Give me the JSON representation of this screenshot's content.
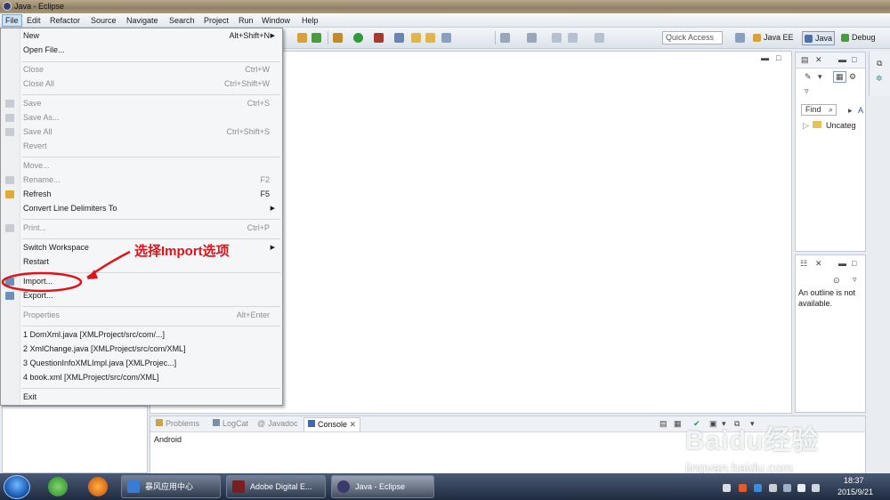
{
  "window": {
    "title": "Java - Eclipse"
  },
  "menubar": [
    "File",
    "Edit",
    "Refactor",
    "Source",
    "Navigate",
    "Search",
    "Project",
    "Run",
    "Window",
    "Help"
  ],
  "file_menu": {
    "items": [
      {
        "label": "New",
        "shortcut": "Alt+Shift+N",
        "arrow": "▶",
        "disabled": false
      },
      {
        "label": "Open File...",
        "shortcut": "",
        "disabled": false
      },
      {
        "label": "Close",
        "shortcut": "Ctrl+W",
        "disabled": true
      },
      {
        "label": "Close All",
        "shortcut": "Ctrl+Shift+W",
        "disabled": true
      },
      {
        "label": "Save",
        "shortcut": "Ctrl+S",
        "disabled": true
      },
      {
        "label": "Save As...",
        "shortcut": "",
        "disabled": true
      },
      {
        "label": "Save All",
        "shortcut": "Ctrl+Shift+S",
        "disabled": true
      },
      {
        "label": "Revert",
        "shortcut": "",
        "disabled": true
      },
      {
        "label": "Move...",
        "shortcut": "",
        "disabled": true
      },
      {
        "label": "Rename...",
        "shortcut": "F2",
        "disabled": true
      },
      {
        "label": "Refresh",
        "shortcut": "F5",
        "disabled": false
      },
      {
        "label": "Convert Line Delimiters To",
        "shortcut": "",
        "arrow": "▶",
        "disabled": false
      },
      {
        "label": "Print...",
        "shortcut": "Ctrl+P",
        "disabled": true
      },
      {
        "label": "Switch Workspace",
        "shortcut": "",
        "arrow": "▶",
        "disabled": false
      },
      {
        "label": "Restart",
        "shortcut": "",
        "disabled": false
      },
      {
        "label": "Import...",
        "shortcut": "",
        "disabled": false
      },
      {
        "label": "Export...",
        "shortcut": "",
        "disabled": false
      },
      {
        "label": "Properties",
        "shortcut": "Alt+Enter",
        "disabled": true
      },
      {
        "label": "1 DomXml.java  [XMLProject/src/com/...]",
        "shortcut": "",
        "disabled": false
      },
      {
        "label": "2 XmlChange.java  [XMLProject/src/com/XML]",
        "shortcut": "",
        "disabled": false
      },
      {
        "label": "3 QuestionInfoXMLImpl.java  [XMLProjec...]",
        "shortcut": "",
        "disabled": false
      },
      {
        "label": "4 book.xml  [XMLProject/src/com/XML]",
        "shortcut": "",
        "disabled": false
      },
      {
        "label": "Exit",
        "shortcut": "",
        "disabled": false
      }
    ]
  },
  "annotation": {
    "text": "选择Import选项",
    "color": "#e0121a"
  },
  "toolbar": {
    "quick_access": "Quick Access",
    "perspectives": [
      {
        "label": "Java EE",
        "active": false
      },
      {
        "label": "Java",
        "active": true
      },
      {
        "label": "Debug",
        "active": false
      }
    ]
  },
  "right_panel": {
    "find": "Find",
    "find_next": "A",
    "tree_item": "Uncateg"
  },
  "outline": {
    "message": "An outline is not available."
  },
  "console": {
    "tabs": [
      {
        "label": "Problems",
        "active": false
      },
      {
        "label": "LogCat",
        "active": false
      },
      {
        "label": "Javadoc",
        "active": false
      },
      {
        "label": "Console",
        "active": true
      }
    ],
    "text": "Android"
  },
  "taskbar": {
    "tasks": [
      {
        "label": "暴风应用中心",
        "active": false
      },
      {
        "label": "Adobe Digital E...",
        "active": false
      },
      {
        "label": "Java - Eclipse",
        "active": true
      }
    ],
    "clock": {
      "time": "18:37",
      "date": "2015/9/21"
    }
  },
  "watermark": {
    "brand": "Baidu经验",
    "url": "jingyan.baidu.com"
  },
  "colors": {
    "accent": "#e0121a",
    "menu_bg": "#f5f6f7",
    "disabled": "#8d8d8d"
  }
}
